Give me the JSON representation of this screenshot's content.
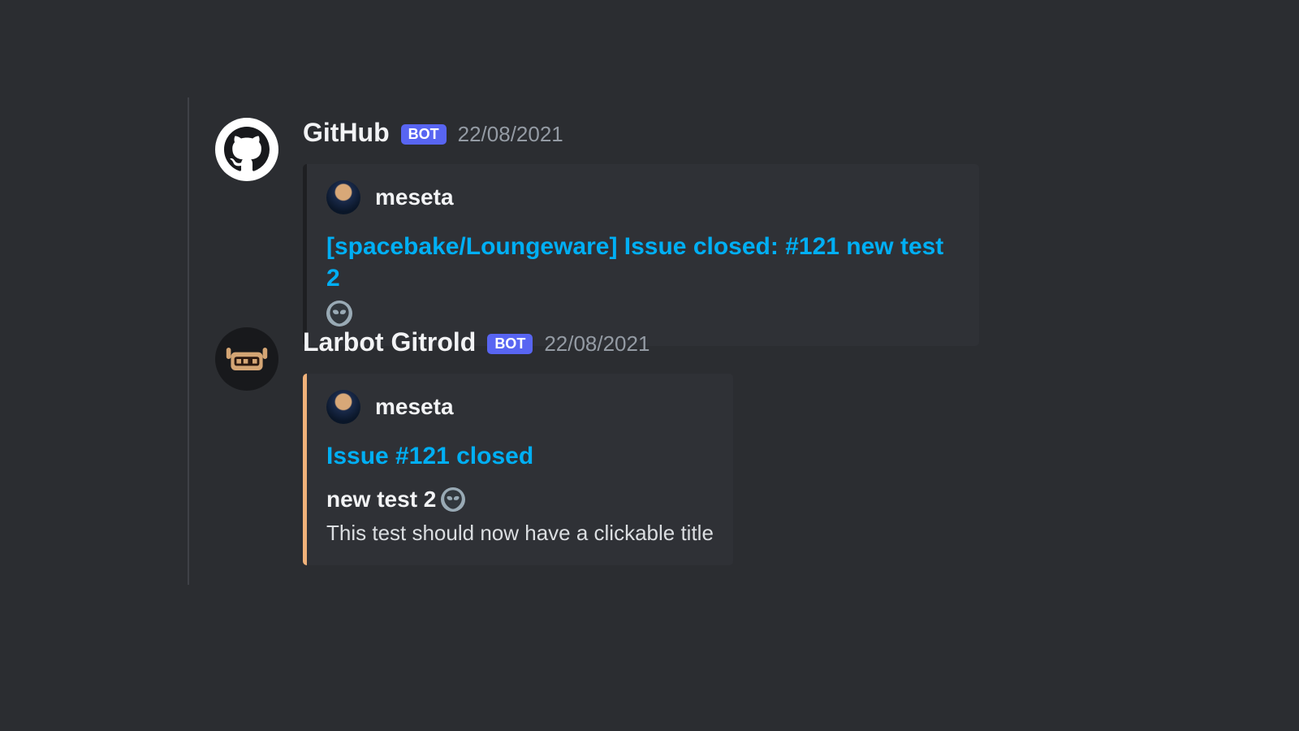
{
  "messages": [
    {
      "username": "GitHub",
      "bot_label": "BOT",
      "timestamp": "22/08/2021",
      "embed": {
        "accent_color": "#1e1f22",
        "author": "meseta",
        "title": "[spacebake/Loungeware] Issue closed: #121 new test 2",
        "title_icon": "alien"
      }
    },
    {
      "username": "Larbot Gitrold",
      "bot_label": "BOT",
      "timestamp": "22/08/2021",
      "embed": {
        "accent_color": "#f0b27a",
        "author": "meseta",
        "title": "Issue #121 closed",
        "subtitle": "new test 2",
        "subtitle_icon": "alien",
        "description": "This test should now have a clickable title"
      }
    }
  ]
}
